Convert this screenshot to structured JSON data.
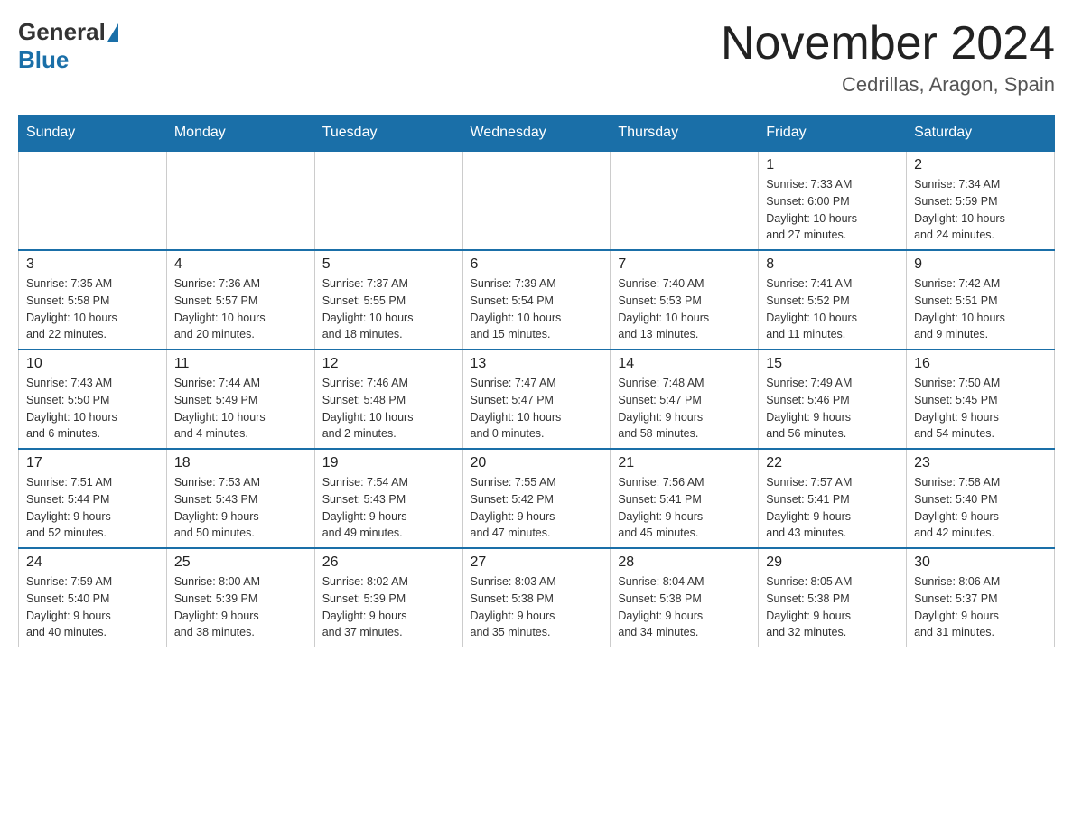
{
  "header": {
    "logo_general": "General",
    "logo_blue": "Blue",
    "month_title": "November 2024",
    "location": "Cedrillas, Aragon, Spain"
  },
  "weekdays": [
    "Sunday",
    "Monday",
    "Tuesday",
    "Wednesday",
    "Thursday",
    "Friday",
    "Saturday"
  ],
  "weeks": [
    [
      {
        "day": "",
        "info": ""
      },
      {
        "day": "",
        "info": ""
      },
      {
        "day": "",
        "info": ""
      },
      {
        "day": "",
        "info": ""
      },
      {
        "day": "",
        "info": ""
      },
      {
        "day": "1",
        "info": "Sunrise: 7:33 AM\nSunset: 6:00 PM\nDaylight: 10 hours\nand 27 minutes."
      },
      {
        "day": "2",
        "info": "Sunrise: 7:34 AM\nSunset: 5:59 PM\nDaylight: 10 hours\nand 24 minutes."
      }
    ],
    [
      {
        "day": "3",
        "info": "Sunrise: 7:35 AM\nSunset: 5:58 PM\nDaylight: 10 hours\nand 22 minutes."
      },
      {
        "day": "4",
        "info": "Sunrise: 7:36 AM\nSunset: 5:57 PM\nDaylight: 10 hours\nand 20 minutes."
      },
      {
        "day": "5",
        "info": "Sunrise: 7:37 AM\nSunset: 5:55 PM\nDaylight: 10 hours\nand 18 minutes."
      },
      {
        "day": "6",
        "info": "Sunrise: 7:39 AM\nSunset: 5:54 PM\nDaylight: 10 hours\nand 15 minutes."
      },
      {
        "day": "7",
        "info": "Sunrise: 7:40 AM\nSunset: 5:53 PM\nDaylight: 10 hours\nand 13 minutes."
      },
      {
        "day": "8",
        "info": "Sunrise: 7:41 AM\nSunset: 5:52 PM\nDaylight: 10 hours\nand 11 minutes."
      },
      {
        "day": "9",
        "info": "Sunrise: 7:42 AM\nSunset: 5:51 PM\nDaylight: 10 hours\nand 9 minutes."
      }
    ],
    [
      {
        "day": "10",
        "info": "Sunrise: 7:43 AM\nSunset: 5:50 PM\nDaylight: 10 hours\nand 6 minutes."
      },
      {
        "day": "11",
        "info": "Sunrise: 7:44 AM\nSunset: 5:49 PM\nDaylight: 10 hours\nand 4 minutes."
      },
      {
        "day": "12",
        "info": "Sunrise: 7:46 AM\nSunset: 5:48 PM\nDaylight: 10 hours\nand 2 minutes."
      },
      {
        "day": "13",
        "info": "Sunrise: 7:47 AM\nSunset: 5:47 PM\nDaylight: 10 hours\nand 0 minutes."
      },
      {
        "day": "14",
        "info": "Sunrise: 7:48 AM\nSunset: 5:47 PM\nDaylight: 9 hours\nand 58 minutes."
      },
      {
        "day": "15",
        "info": "Sunrise: 7:49 AM\nSunset: 5:46 PM\nDaylight: 9 hours\nand 56 minutes."
      },
      {
        "day": "16",
        "info": "Sunrise: 7:50 AM\nSunset: 5:45 PM\nDaylight: 9 hours\nand 54 minutes."
      }
    ],
    [
      {
        "day": "17",
        "info": "Sunrise: 7:51 AM\nSunset: 5:44 PM\nDaylight: 9 hours\nand 52 minutes."
      },
      {
        "day": "18",
        "info": "Sunrise: 7:53 AM\nSunset: 5:43 PM\nDaylight: 9 hours\nand 50 minutes."
      },
      {
        "day": "19",
        "info": "Sunrise: 7:54 AM\nSunset: 5:43 PM\nDaylight: 9 hours\nand 49 minutes."
      },
      {
        "day": "20",
        "info": "Sunrise: 7:55 AM\nSunset: 5:42 PM\nDaylight: 9 hours\nand 47 minutes."
      },
      {
        "day": "21",
        "info": "Sunrise: 7:56 AM\nSunset: 5:41 PM\nDaylight: 9 hours\nand 45 minutes."
      },
      {
        "day": "22",
        "info": "Sunrise: 7:57 AM\nSunset: 5:41 PM\nDaylight: 9 hours\nand 43 minutes."
      },
      {
        "day": "23",
        "info": "Sunrise: 7:58 AM\nSunset: 5:40 PM\nDaylight: 9 hours\nand 42 minutes."
      }
    ],
    [
      {
        "day": "24",
        "info": "Sunrise: 7:59 AM\nSunset: 5:40 PM\nDaylight: 9 hours\nand 40 minutes."
      },
      {
        "day": "25",
        "info": "Sunrise: 8:00 AM\nSunset: 5:39 PM\nDaylight: 9 hours\nand 38 minutes."
      },
      {
        "day": "26",
        "info": "Sunrise: 8:02 AM\nSunset: 5:39 PM\nDaylight: 9 hours\nand 37 minutes."
      },
      {
        "day": "27",
        "info": "Sunrise: 8:03 AM\nSunset: 5:38 PM\nDaylight: 9 hours\nand 35 minutes."
      },
      {
        "day": "28",
        "info": "Sunrise: 8:04 AM\nSunset: 5:38 PM\nDaylight: 9 hours\nand 34 minutes."
      },
      {
        "day": "29",
        "info": "Sunrise: 8:05 AM\nSunset: 5:38 PM\nDaylight: 9 hours\nand 32 minutes."
      },
      {
        "day": "30",
        "info": "Sunrise: 8:06 AM\nSunset: 5:37 PM\nDaylight: 9 hours\nand 31 minutes."
      }
    ]
  ]
}
